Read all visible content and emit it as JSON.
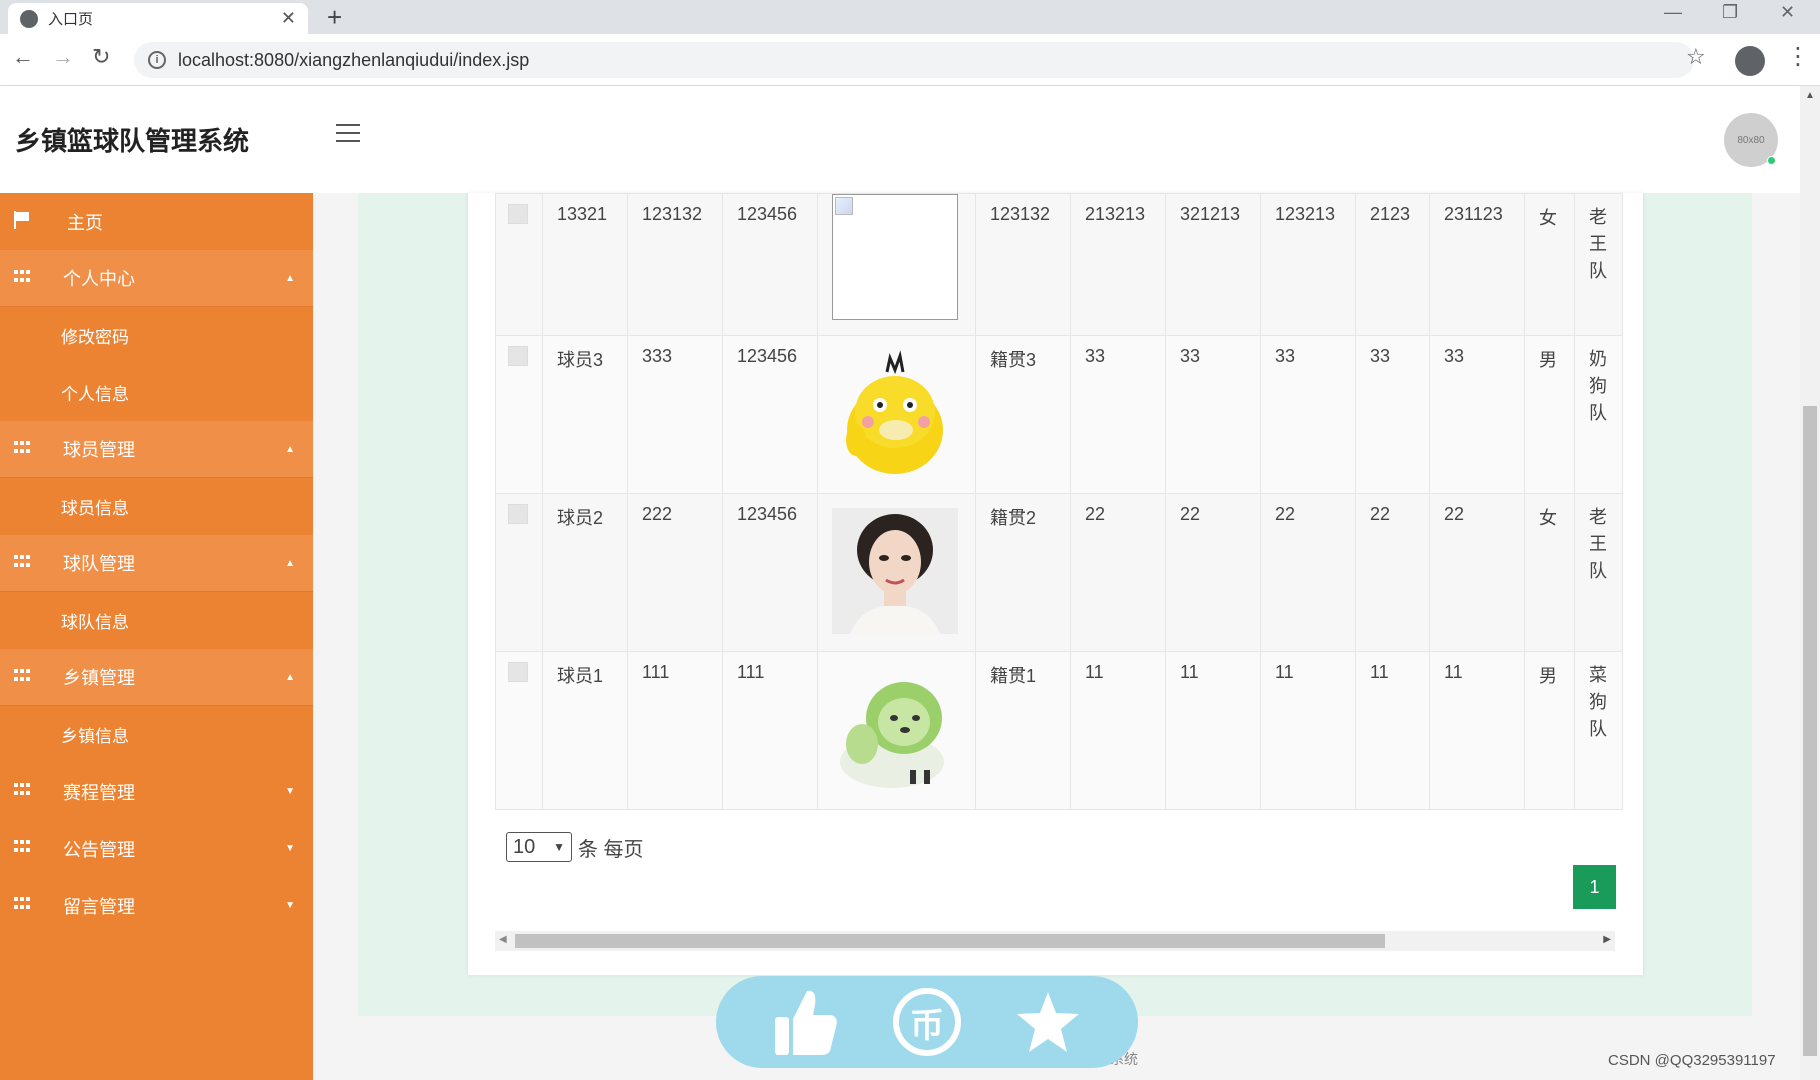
{
  "browser": {
    "tab_title": "入口页",
    "url": "localhost:8080/xiangzhenlanqiudui/index.jsp"
  },
  "app": {
    "title": "乡镇篮球队管理系统",
    "avatar_text": "80x80"
  },
  "sidebar": {
    "items": [
      {
        "label": "主页",
        "kind": "top",
        "icon": "flag-icon"
      },
      {
        "label": "个人中心",
        "kind": "group",
        "icon": "grid-icon",
        "caret": "up"
      },
      {
        "label": "修改密码",
        "kind": "sub"
      },
      {
        "label": "个人信息",
        "kind": "sub"
      },
      {
        "label": "球员管理",
        "kind": "group",
        "icon": "grid-icon",
        "caret": "up"
      },
      {
        "label": "球员信息",
        "kind": "sub"
      },
      {
        "label": "球队管理",
        "kind": "group",
        "icon": "grid-icon",
        "caret": "up"
      },
      {
        "label": "球队信息",
        "kind": "sub"
      },
      {
        "label": "乡镇管理",
        "kind": "group",
        "icon": "grid-icon",
        "caret": "up"
      },
      {
        "label": "乡镇信息",
        "kind": "sub"
      },
      {
        "label": "赛程管理",
        "kind": "group",
        "icon": "grid-icon",
        "caret": "down"
      },
      {
        "label": "公告管理",
        "kind": "group",
        "icon": "grid-icon",
        "caret": "down"
      },
      {
        "label": "留言管理",
        "kind": "group",
        "icon": "grid-icon",
        "caret": "down"
      }
    ]
  },
  "table": {
    "rows": [
      {
        "name": "13321",
        "c1": "123132",
        "c2": "123456",
        "photo": "broken-image",
        "origin": "123132",
        "c3": "213213",
        "c4": "321213",
        "c5": "123213",
        "c6": "2123",
        "c7": "231123",
        "gender": "女",
        "team": "老王队"
      },
      {
        "name": "球员3",
        "c1": "333",
        "c2": "123456",
        "photo": "yellow-duck",
        "origin": "籍贯3",
        "c3": "33",
        "c4": "33",
        "c5": "33",
        "c6": "33",
        "c7": "33",
        "gender": "男",
        "team": "奶狗队"
      },
      {
        "name": "球员2",
        "c1": "222",
        "c2": "123456",
        "photo": "woman-portrait",
        "origin": "籍贯2",
        "c3": "22",
        "c4": "22",
        "c5": "22",
        "c6": "22",
        "c7": "22",
        "gender": "女",
        "team": "老王队"
      },
      {
        "name": "球员1",
        "c1": "111",
        "c2": "111",
        "photo": "cabbage-dog",
        "origin": "籍贯1",
        "c3": "11",
        "c4": "11",
        "c5": "11",
        "c6": "11",
        "c7": "11",
        "gender": "男",
        "team": "菜狗队"
      }
    ]
  },
  "pager": {
    "page_size": "10",
    "per_page_label": "条 每页",
    "current_page": "1"
  },
  "footer": {
    "partial_text": "系统"
  },
  "watermark": "CSDN @QQ3295391197",
  "colors": {
    "sidebar": "#ec8333",
    "sidebar_group": "#f08f48",
    "page_active": "#1a9b5a",
    "action_bar": "#9ed9ec"
  }
}
